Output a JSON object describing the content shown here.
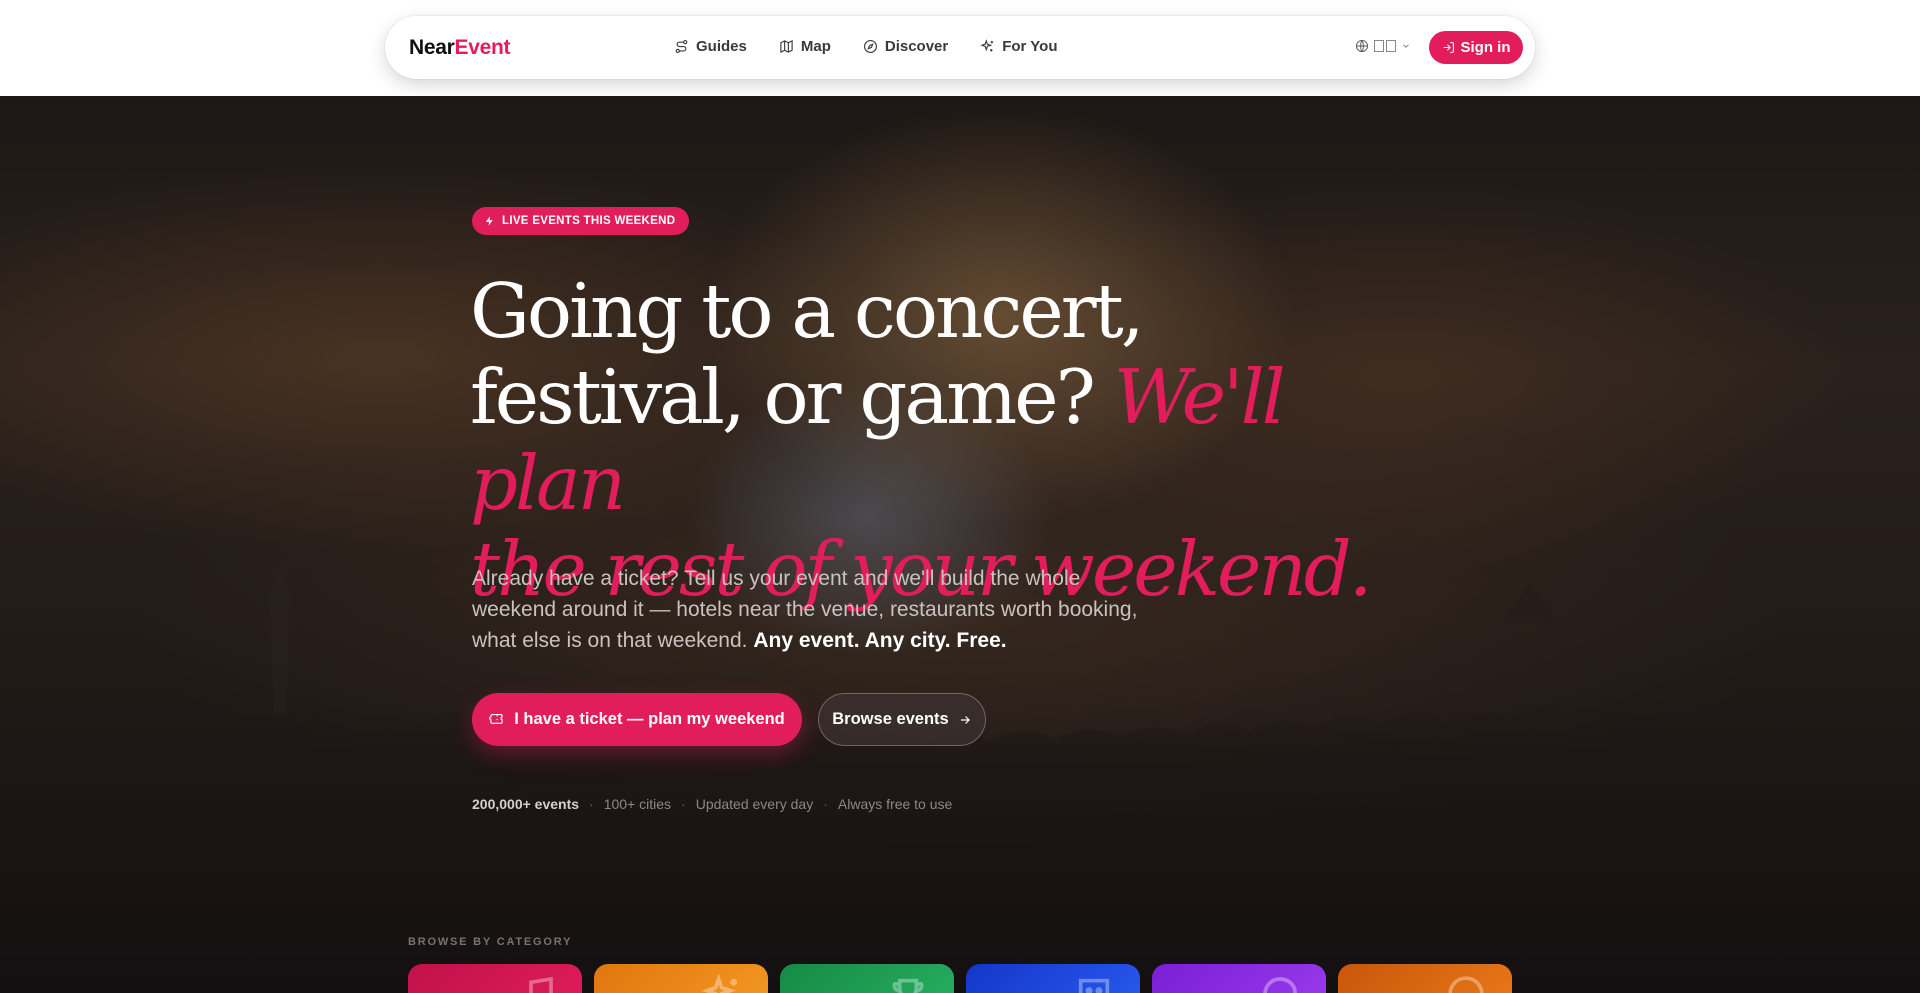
{
  "brand": {
    "name_part1": "Near",
    "name_part2": "Event",
    "accent_color": "#e11d5c"
  },
  "nav": {
    "links": [
      {
        "label": "Guides",
        "icon": "route-icon"
      },
      {
        "label": "Map",
        "icon": "map-icon"
      },
      {
        "label": "Discover",
        "icon": "compass-icon"
      },
      {
        "label": "For You",
        "icon": "sparkles-icon"
      }
    ],
    "language_icon": "globe-icon",
    "language_dropdown_icon": "chevron-down-icon",
    "sign_in_label": "Sign in",
    "sign_in_icon": "log-in-icon"
  },
  "hero": {
    "badge": "LIVE EVENTS THIS WEEKEND",
    "badge_icon": "lightning-icon",
    "headline_line1": "Going to a concert,",
    "headline_line2": "festival, or game?",
    "headline_accent_1": "We'll plan",
    "headline_accent_2": "the rest of your weekend.",
    "subtext": "Already have a ticket? Tell us your event and we'll build the whole weekend around it — hotels near the venue, restaurants worth booking, what else is on that weekend.",
    "subtext_bold": "Any event. Any city. Free.",
    "primary_cta": "I have a ticket — plan my weekend",
    "primary_cta_icon": "ticket-icon",
    "secondary_cta": "Browse events",
    "secondary_cta_icon": "arrow-right-icon",
    "stats": [
      "200,000+ events",
      "100+ cities",
      "Updated every day",
      "Always free to use"
    ],
    "stats_separator": "·"
  },
  "categories": {
    "label": "BROWSE BY CATEGORY",
    "tiles": [
      {
        "color": "#e11d5c",
        "icon": "music-icon"
      },
      {
        "color": "#f28c1a",
        "icon": "sparkles-icon"
      },
      {
        "color": "#22a355",
        "icon": "trophy-icon"
      },
      {
        "color": "#1f4fe0",
        "icon": "mask-icon"
      },
      {
        "color": "#8b2be2",
        "icon": "palette-icon"
      },
      {
        "color": "#e3690f",
        "icon": "smile-icon"
      }
    ]
  }
}
